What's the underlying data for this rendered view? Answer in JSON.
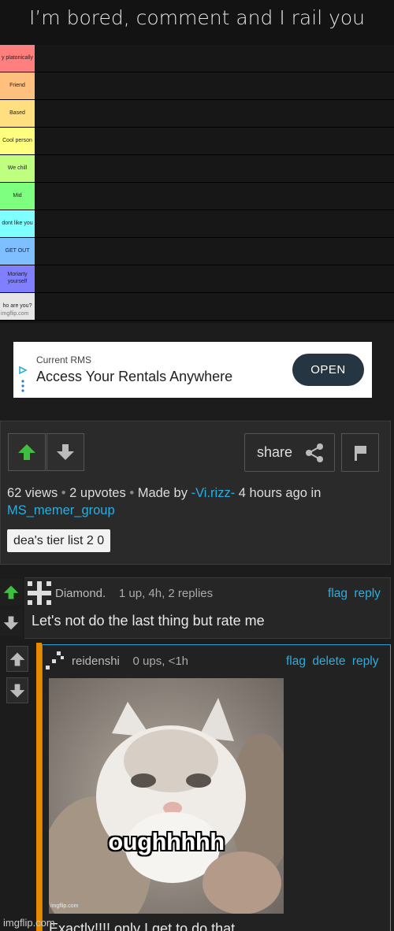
{
  "meme": {
    "title": "I’m bored, comment and I rail you",
    "tiers": [
      {
        "label": "y platonically",
        "color": "#ff7f7f"
      },
      {
        "label": "Friend",
        "color": "#ffbf7f"
      },
      {
        "label": "Based",
        "color": "#ffdf7f"
      },
      {
        "label": "Cool person",
        "color": "#ffff7f"
      },
      {
        "label": "We chill",
        "color": "#bfff7f"
      },
      {
        "label": "Mid",
        "color": "#7fff7f"
      },
      {
        "label": "dont like you",
        "color": "#7fffff"
      },
      {
        "label": "GET OUT",
        "color": "#7fbfff"
      },
      {
        "label": "Moriarty yourself",
        "color": "#7f7fff"
      },
      {
        "label": "ho are you?",
        "color": "#e6e6e6"
      }
    ],
    "watermark": "imgflip.com"
  },
  "ad": {
    "small_text": "Current RMS",
    "main_text": "Access Your Rentals Anywhere",
    "button_label": "OPEN"
  },
  "post": {
    "share_label": "share",
    "views": "62 views",
    "upvotes": "2 upvotes",
    "made_by_prefix": "Made by",
    "author": "-Vi.rizz-",
    "time_in": "4 hours ago in",
    "group": "MS_memer_group",
    "tag": "dea's tier list 2 0",
    "colors": {
      "accent": "#2aaee0",
      "upvote": "#3fbf3f"
    }
  },
  "comments": [
    {
      "username": "Diamond.",
      "stats": "1 up, 4h, 2 replies",
      "actions": [
        "flag",
        "reply"
      ],
      "text": "Let's not do the last thing but rate me"
    },
    {
      "username": "reidenshi",
      "stats": "0 ups, <1h",
      "actions": [
        "flag",
        "delete",
        "reply"
      ],
      "image_caption": "oughhhhh",
      "image_watermark": "imgflip.com",
      "text": "Exactly!!!! only I get to do that"
    }
  ],
  "page_watermark": "imgflip.com"
}
